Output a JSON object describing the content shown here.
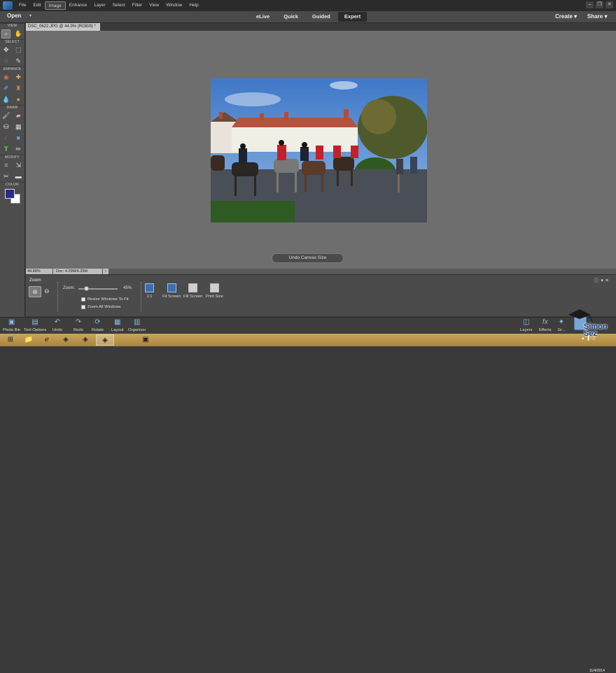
{
  "menubar": {
    "items": [
      "File",
      "Edit",
      "Image",
      "Enhance",
      "Layer",
      "Select",
      "Filter",
      "View",
      "Window",
      "Help"
    ],
    "active_index": 2
  },
  "modebar": {
    "open_label": "Open",
    "tabs": [
      "eLive",
      "Quick",
      "Guided",
      "Expert"
    ],
    "active_tab": "Expert",
    "create_label": "Create",
    "share_label": "Share"
  },
  "toolbox": {
    "sections": [
      "VIEW",
      "SELECT",
      "ENHANCE",
      "DRAW",
      "MODIFY",
      "COLOR"
    ],
    "foreground_color": "#2a2a8c",
    "background_color": "#ffffff"
  },
  "document": {
    "tab_title": "DSC_0622.JPG @ 44.9% (RGB/8) *"
  },
  "canvas": {
    "undo_label": "Undo Canvas Size"
  },
  "status": {
    "zoom": "44.88%",
    "doc_info": "Doc: 4.29M/4.29M"
  },
  "options": {
    "title": "Zoom",
    "zoom_label": "Zoom:",
    "zoom_value": "45%",
    "zoom_level": 0.45,
    "resize_label": "Resize Windows To Fit",
    "zoom_all_label": "Zoom All Windows",
    "buttons": [
      "1:1",
      "Fit Screen",
      "Fill Screen",
      "Print Size"
    ]
  },
  "bottombar": {
    "left": [
      "Photo Bin",
      "Tool Options",
      "Undo",
      "Redo",
      "Rotate",
      "Layout",
      "Organizer"
    ],
    "right": [
      "Layers",
      "Effects",
      "Gr..."
    ]
  },
  "watermark": {
    "line1": "Simon",
    "line2": "Sez"
  },
  "taskbar": {
    "date": "11/4/2014"
  }
}
